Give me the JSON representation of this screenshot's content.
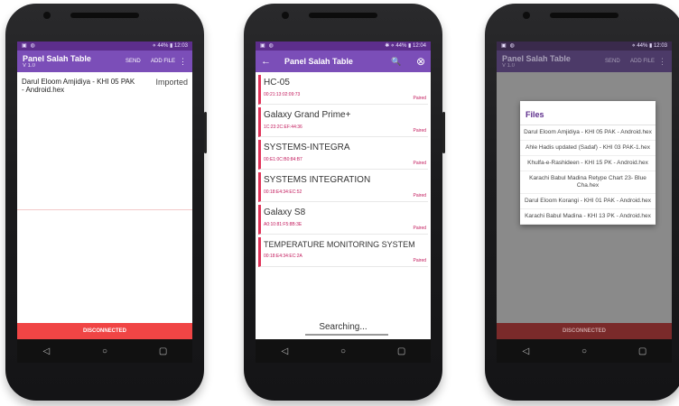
{
  "phone1": {
    "status": {
      "left": [
        "▣",
        "◍"
      ],
      "right": "⋄ 44% ▮ 12:03"
    },
    "app": {
      "title": "Panel Salah Table",
      "version": "V 1.0",
      "send": "SEND",
      "add_file": "ADD FILE",
      "menu": "⋮"
    },
    "file": {
      "name": "Darul Eloom Amjidiya - KHI 05 PAK - Android.hex",
      "status": "Imported"
    },
    "bottom_status": "DISCONNECTED",
    "nav": {
      "back": "◁",
      "home": "○",
      "recent": "▢"
    }
  },
  "phone2": {
    "status": {
      "left": [
        "▣",
        "◍"
      ],
      "right": "✱ ⋄ 44% ▮ 12:04"
    },
    "app": {
      "back": "←",
      "title": "Panel Salah Table",
      "search": "🔍",
      "close": "⊗"
    },
    "devices": [
      {
        "name": "HC-05",
        "mac": "00:21:13:02:09:73",
        "state": "Paired"
      },
      {
        "name": "Galaxy Grand Prime+",
        "mac": "1C:23:2C:EF:44:36",
        "state": "Paired"
      },
      {
        "name": "SYSTEMS-INTEGRA",
        "mac": "00:E1:0C:B0:84:B7",
        "state": "Paired"
      },
      {
        "name": "SYSTEMS INTEGRATION",
        "mac": "00:18:E4:34:EC:52",
        "state": "Paired"
      },
      {
        "name": "Galaxy S8",
        "mac": "A0:10:81:F5:8B:3E",
        "state": "Paired"
      },
      {
        "name": "TEMPERATURE MONITORING SYSTEM",
        "mac": "00:18:E4:34:EC:2A",
        "state": "Paired"
      }
    ],
    "searching": "Searching...",
    "nav": {
      "back": "◁",
      "home": "○",
      "recent": "▢"
    }
  },
  "phone3": {
    "status": {
      "left": [
        "▣",
        "◍"
      ],
      "right": "⋄ 44% ▮ 12:03"
    },
    "app": {
      "title": "Panel Salah Table",
      "version": "V 1.0",
      "send": "SEND",
      "add_file": "ADD FILE",
      "menu": "⋮"
    },
    "dialog": {
      "title": "Files",
      "items": [
        "Darul Eloom Amjidiya - KHI 05 PAK - Android.hex",
        "Ahle Hadis updated (Sadaf) - KHI 03 PAK-1.hex",
        "Khulfa-e-Rashideen - KHI 15 PK - Android.hex",
        "Karachi Babul Madina Retype Chart 23- Blue Cha.hex",
        "Darul Eloom Korangi - KHI 01 PAK - Android.hex",
        "Karachi Babul Madina - KHI 13 PK - Android.hex"
      ]
    },
    "bottom_status": "DISCONNECTED",
    "nav": {
      "back": "◁",
      "home": "○",
      "recent": "▢"
    }
  }
}
